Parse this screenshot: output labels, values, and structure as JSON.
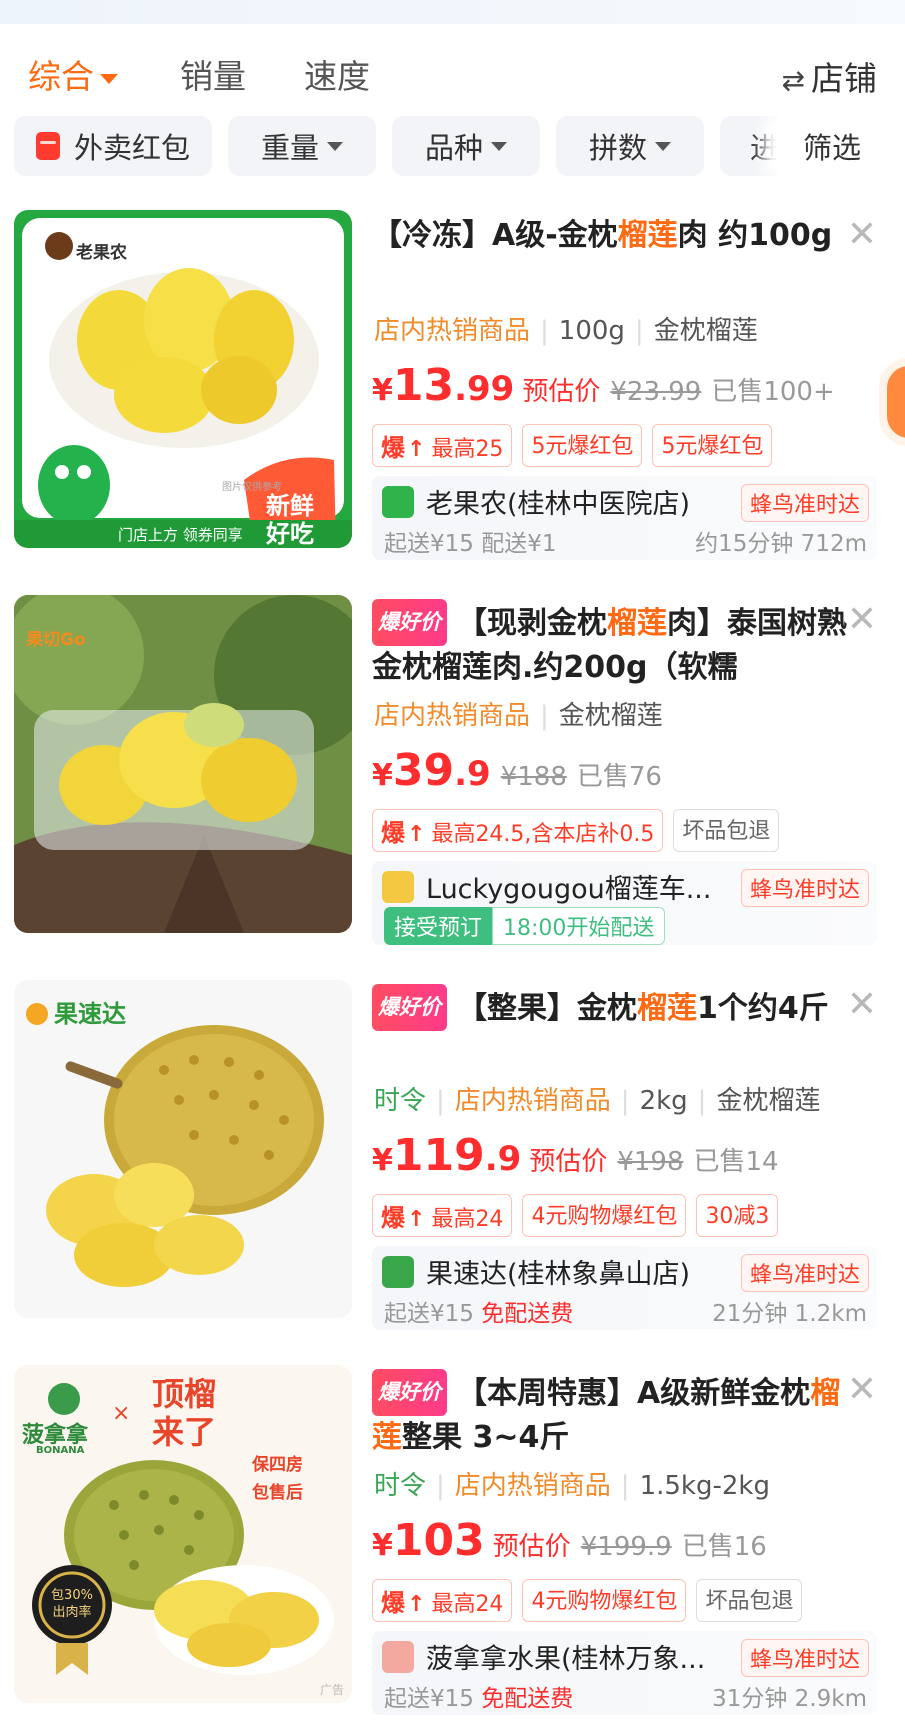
{
  "sort": {
    "tabs": [
      "综合",
      "销量",
      "速度"
    ],
    "store_label": "店铺"
  },
  "filters": {
    "chips": [
      "外卖红包",
      "重量",
      "品种",
      "拼数",
      "进店"
    ],
    "filter_label": "筛选"
  },
  "colors": {
    "accent": "#ff6a13",
    "price": "#ff2d2d",
    "green": "#3fbf7f"
  },
  "products": [
    {
      "title_pre": "【冷冻】A级-金枕",
      "title_hl": "榴莲",
      "title_post": "肉 约100g",
      "badge": "",
      "img_brand": "老果农",
      "img_slogan": "新鲜好吃",
      "img_footer": "门店上方 领券同享",
      "meta_prefix": "",
      "meta_orange": "店内热销商品",
      "meta_rest": [
        "100g",
        "金枕榴莲"
      ],
      "price_int": "13",
      "price_dec": ".99",
      "est": "预估价",
      "orig": "¥23.99",
      "sold": "已售100+",
      "tags": [
        {
          "type": "bao",
          "text": "最高25"
        },
        {
          "type": "red",
          "text": "5元爆红包"
        },
        {
          "type": "red",
          "text": "5元爆红包"
        }
      ],
      "shop": {
        "name": "老果农(桂林中医院店)",
        "deliver": "蜂鸟准时达",
        "sub": "起送¥15 配送¥1",
        "sub_red": "",
        "dist": "约15分钟 712m",
        "preorder": null
      }
    },
    {
      "title_pre": "【现剥金枕",
      "title_hl": "榴莲",
      "title_post": "肉】泰国树熟金枕榴莲肉.约200g（软糯",
      "badge": "爆好价",
      "img_brand": "果切Go",
      "img_slogan": "",
      "img_footer": "",
      "meta_prefix": "",
      "meta_orange": "店内热销商品",
      "meta_rest": [
        "金枕榴莲"
      ],
      "price_int": "39",
      "price_dec": ".9",
      "est": "",
      "orig": "¥188",
      "sold": "已售76",
      "tags": [
        {
          "type": "bao",
          "text": "最高24.5,含本店补0.5"
        },
        {
          "type": "gray",
          "text": "坏品包退"
        }
      ],
      "shop": {
        "name": "Luckygougou榴莲车...",
        "deliver": "蜂鸟准时达",
        "sub": "",
        "sub_red": "",
        "dist": "",
        "preorder": [
          "接受预订",
          "18:00开始配送"
        ]
      }
    },
    {
      "title_pre": "【整果】金枕",
      "title_hl": "榴莲",
      "title_post": "1个约4斤",
      "badge": "爆好价",
      "img_brand": "果速达",
      "img_slogan": "",
      "img_footer": "",
      "meta_prefix": "时令",
      "meta_orange": "店内热销商品",
      "meta_rest": [
        "2kg",
        "金枕榴莲"
      ],
      "price_int": "119",
      "price_dec": ".9",
      "est": "预估价",
      "orig": "¥198",
      "sold": "已售14",
      "tags": [
        {
          "type": "bao",
          "text": "最高24"
        },
        {
          "type": "red",
          "text": "4元购物爆红包"
        },
        {
          "type": "red",
          "text": "30减3"
        }
      ],
      "shop": {
        "name": "果速达(桂林象鼻山店)",
        "deliver": "蜂鸟准时达",
        "sub": "起送¥15 ",
        "sub_red": "免配送费",
        "dist": "21分钟 1.2km",
        "preorder": null
      }
    },
    {
      "title_pre": "【本周特惠】A级新鲜金枕",
      "title_hl": "榴莲",
      "title_post": "整果 3~4斤",
      "badge": "爆好价",
      "img_brand": "菠拿拿",
      "img_slogan": "顶榴来了",
      "img_footer": "包30%出肉率",
      "meta_prefix": "时令",
      "meta_orange": "店内热销商品",
      "meta_rest": [
        "1.5kg-2kg"
      ],
      "price_int": "103",
      "price_dec": "",
      "est": "预估价",
      "orig": "¥199.9",
      "sold": "已售16",
      "tags": [
        {
          "type": "bao",
          "text": "最高24"
        },
        {
          "type": "red",
          "text": "4元购物爆红包"
        },
        {
          "type": "gray",
          "text": "坏品包退"
        }
      ],
      "shop": {
        "name": "菠拿拿水果(桂林万象...",
        "deliver": "蜂鸟准时达",
        "sub": "起送¥15 ",
        "sub_red": "免配送费",
        "dist": "31分钟 2.9km",
        "preorder": null
      }
    }
  ],
  "labels": {
    "bao": "爆",
    "img_note": "图片仅供参考",
    "img4_note1": "保四房",
    "img4_note2": "包售后",
    "img4_brand_en": "BONANA",
    "ad": "广告"
  }
}
